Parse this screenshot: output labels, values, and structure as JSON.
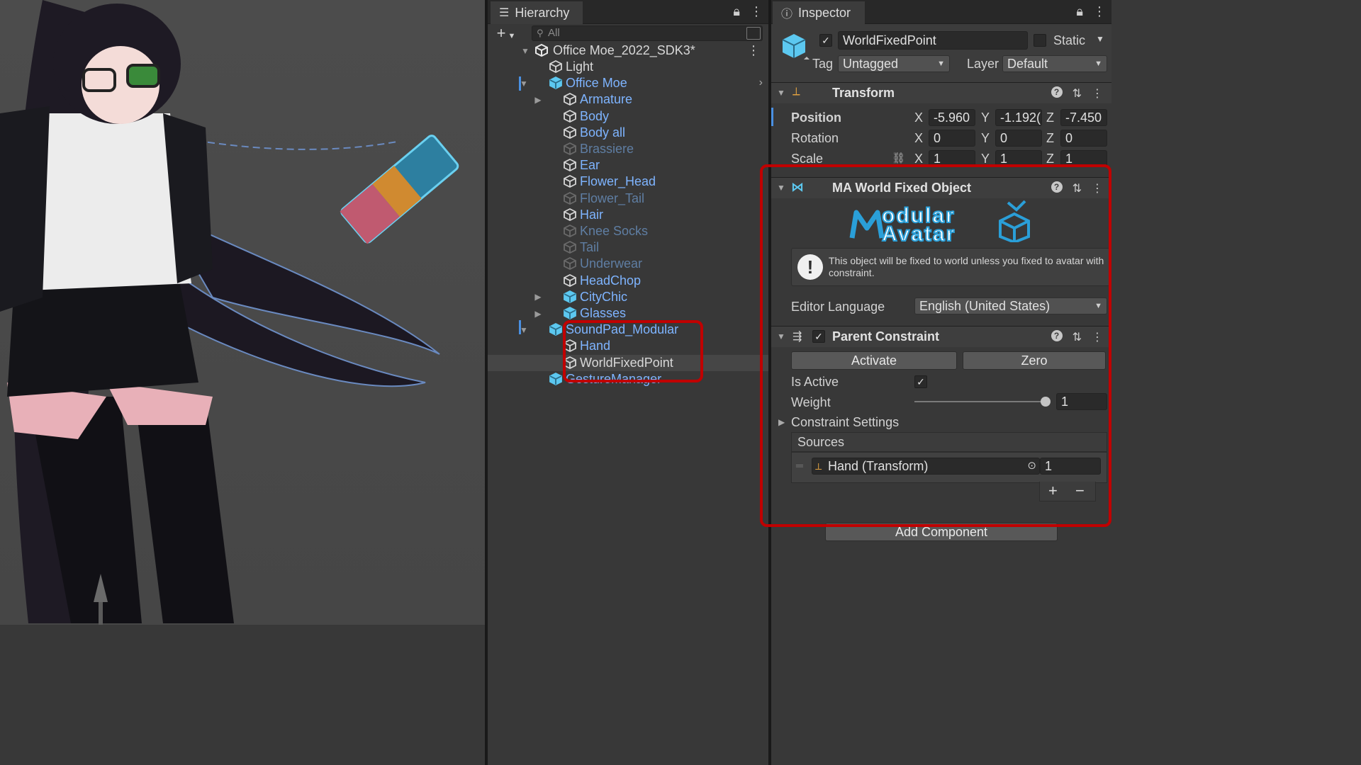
{
  "hierarchy": {
    "tab_label": "Hierarchy",
    "search_placeholder": "All",
    "scene_name": "Office Moe_2022_SDK3*",
    "items": [
      {
        "label": "Light",
        "style": "white",
        "arrow": ""
      },
      {
        "label": "Office Moe",
        "style": "blue",
        "arrow": "▼"
      },
      {
        "label": "Armature",
        "style": "blue",
        "arrow": "▶"
      },
      {
        "label": "Body",
        "style": "blue",
        "arrow": ""
      },
      {
        "label": "Body all",
        "style": "blue",
        "arrow": ""
      },
      {
        "label": "Brassiere",
        "style": "dim",
        "arrow": ""
      },
      {
        "label": "Ear",
        "style": "blue",
        "arrow": ""
      },
      {
        "label": "Flower_Head",
        "style": "blue",
        "arrow": ""
      },
      {
        "label": "Flower_Tail",
        "style": "dim",
        "arrow": ""
      },
      {
        "label": "Hair",
        "style": "blue",
        "arrow": ""
      },
      {
        "label": "Knee Socks",
        "style": "dim",
        "arrow": ""
      },
      {
        "label": "Tail",
        "style": "dim",
        "arrow": ""
      },
      {
        "label": "Underwear",
        "style": "dim",
        "arrow": ""
      },
      {
        "label": "HeadChop",
        "style": "blue",
        "arrow": ""
      },
      {
        "label": "CityChic",
        "style": "blue",
        "arrow": "▶"
      },
      {
        "label": "Glasses",
        "style": "blue",
        "arrow": "▶"
      },
      {
        "label": "SoundPad_Modular",
        "style": "blue",
        "arrow": "▼"
      },
      {
        "label": "Hand",
        "style": "blue",
        "arrow": ""
      },
      {
        "label": "WorldFixedPoint",
        "style": "white",
        "arrow": ""
      },
      {
        "label": "GestureManager",
        "style": "blue",
        "arrow": ""
      }
    ]
  },
  "inspector": {
    "tab_label": "Inspector",
    "object_name": "WorldFixedPoint",
    "static_label": "Static",
    "tag_label": "Tag",
    "tag_value": "Untagged",
    "layer_label": "Layer",
    "layer_value": "Default",
    "transform": {
      "title": "Transform",
      "position_label": "Position",
      "rotation_label": "Rotation",
      "scale_label": "Scale",
      "position": [
        "-5.960",
        "-1.192(",
        "-7.450"
      ],
      "rotation": [
        "0",
        "0",
        "0"
      ],
      "scale": [
        "1",
        "1",
        "1"
      ],
      "axes": [
        "X",
        "Y",
        "Z"
      ]
    },
    "ma_component": {
      "title": "MA World Fixed Object",
      "logo_line1": "odular",
      "logo_line2": "Avatar",
      "info_text": "This object will be fixed to world unless you fixed to avatar with constraint.",
      "editor_language_label": "Editor Language",
      "editor_language_value": "English (United States)"
    },
    "parent_constraint": {
      "title": "Parent Constraint",
      "activate_label": "Activate",
      "zero_label": "Zero",
      "is_active_label": "Is Active",
      "weight_label": "Weight",
      "weight_value": "1",
      "weight_level": 1.0,
      "settings_label": "Constraint Settings",
      "sources_label": "Sources",
      "source_name": "Hand (Transform)",
      "source_weight": "1"
    },
    "add_component_label": "Add Component"
  },
  "colors": {
    "highlight": "#c00000",
    "blue_text": "#7eb4ff",
    "accent_cube": "#5cc8f0"
  }
}
